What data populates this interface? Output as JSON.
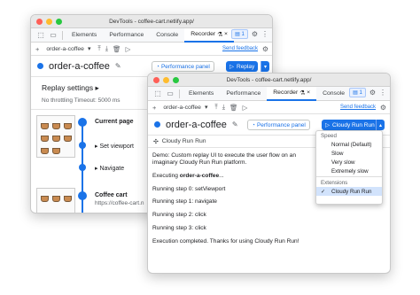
{
  "back": {
    "title": "DevTools - coffee-cart.netlify.app/",
    "tabs": [
      "Elements",
      "Performance",
      "Console",
      "Recorder",
      "»"
    ],
    "recorder_tab_label": "Recorder",
    "issues_count": "1",
    "recording_select": "order-a-coffee",
    "send_feedback": "Send feedback",
    "recording_title": "order-a-coffee",
    "performance_panel": "Performance panel",
    "replay": "Replay",
    "settings_title": "Replay settings",
    "settings_sub": "No throttling  Timeout: 5000 ms",
    "steps": {
      "current_page": "Current page",
      "set_viewport": "Set viewport",
      "navigate": "Navigate",
      "coffee_cart": "Coffee cart",
      "coffee_cart_url": "https://coffee-cart.n"
    }
  },
  "front": {
    "title": "DevTools - coffee-cart.netlify.app/",
    "tabs": [
      "Elements",
      "Performance",
      "Recorder",
      "Console",
      "»"
    ],
    "issues_count": "1",
    "recording_select": "order-a-coffee",
    "send_feedback": "Send feedback",
    "recording_title": "order-a-coffee",
    "performance_panel": "Performance panel",
    "replay_button": "Cloudy Run Run",
    "panel_name": "Cloudy Run Run",
    "log": {
      "line1": "Demo: Custom replay UI to execute the user flow on an imaginary Cloudy Run Run platform.",
      "line2_prefix": "Executing ",
      "line2_bold": "order-a-coffee",
      "line2_suffix": "...",
      "line3": "Running step 0: setViewport",
      "line4": "Running step 1: navigate",
      "line5": "Running step 2: click",
      "line6": "Running step 3: click",
      "line7": "Execution completed. Thanks for using Cloudy Run Run!"
    },
    "menu": {
      "speed_label": "Speed",
      "speeds": [
        "Normal (Default)",
        "Slow",
        "Very slow",
        "Extremely slow"
      ],
      "extensions_label": "Extensions",
      "extension_item": "Cloudy Run Run"
    }
  },
  "colors": {
    "accent": "#1a73e8",
    "menu_selected": "#d2e3fc"
  },
  "icons": [
    "inspect-icon",
    "device-icon",
    "add-icon",
    "upload-icon",
    "download-icon",
    "delete-icon",
    "play-icon",
    "gear-icon",
    "kebab-icon",
    "pencil-icon",
    "chevron-right-icon",
    "performance-icon",
    "puzzle-icon",
    "check-icon",
    "close-icon"
  ]
}
